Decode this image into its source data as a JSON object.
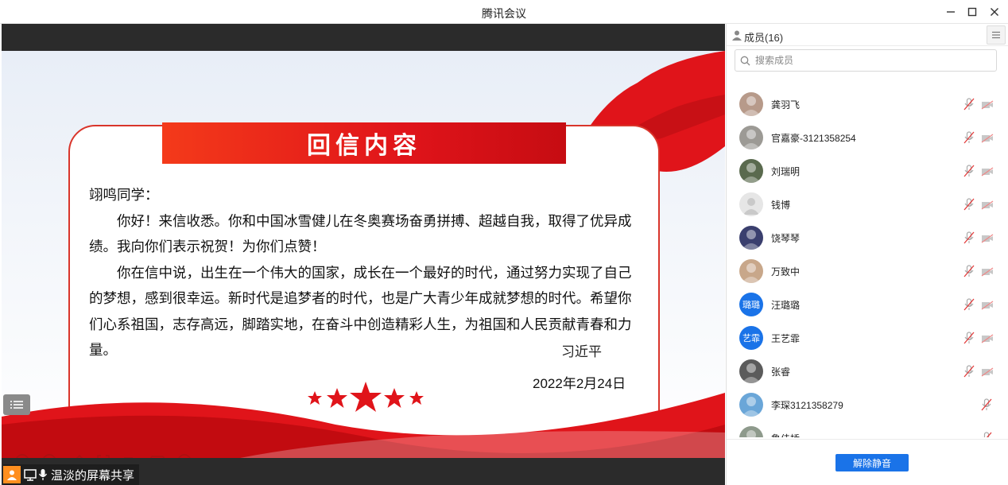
{
  "window": {
    "title": "腾讯会议"
  },
  "slide": {
    "heading": "回信内容",
    "salutation": "翊鸣同学：",
    "paragraph1": "你好！来信收悉。你和中国冰雪健儿在冬奥赛场奋勇拼搏、超越自我，取得了优异成绩。我向你们表示祝贺！为你们点赞！",
    "paragraph2": "你在信中说，出生在一个伟大的国家，成长在一个最好的时代，通过努力实现了自己的梦想，感到很幸运。新时代是追梦者的时代，也是广大青少年成就梦想的时代。希望你们心系祖国，志存高远，脚踏实地，在奋斗中创造精彩人生，为祖国和人民贡献青春和力量。",
    "signature": "习近平",
    "date": "2022年2月24日"
  },
  "share": {
    "label": "温淡的屏幕共享"
  },
  "panel": {
    "title": "成员(16)",
    "search_placeholder": "搜索成员",
    "members": [
      {
        "name": "龚羽飞",
        "avatar": "photo",
        "avatar_color": "#b79a8a",
        "cam": true
      },
      {
        "name": "官嘉豪-3121358254",
        "avatar": "photo",
        "avatar_color": "#9c9a95",
        "cam": true
      },
      {
        "name": "刘瑞明",
        "avatar": "photo",
        "avatar_color": "#5a6a4e",
        "cam": true
      },
      {
        "name": "钱博",
        "avatar": "default",
        "avatar_color": "#e6e6e6",
        "cam": true
      },
      {
        "name": "饶琴琴",
        "avatar": "photo",
        "avatar_color": "#3a3f6e",
        "cam": true
      },
      {
        "name": "万致中",
        "avatar": "photo",
        "avatar_color": "#c8a78a",
        "cam": true
      },
      {
        "name": "汪璐璐",
        "avatar": "text",
        "avatar_text": "璐璐",
        "avatar_color": "#1a73e8",
        "cam": true
      },
      {
        "name": "王艺霏",
        "avatar": "text",
        "avatar_text": "艺霏",
        "avatar_color": "#1a73e8",
        "cam": true
      },
      {
        "name": "张睿",
        "avatar": "photo",
        "avatar_color": "#5b5b5b",
        "cam": true
      },
      {
        "name": "李琛3121358279",
        "avatar": "photo",
        "avatar_color": "#6aa6d8",
        "cam": false
      },
      {
        "name": "鲁佳桥",
        "avatar": "photo",
        "avatar_color": "#8e9a8c",
        "cam": false
      }
    ],
    "unmute_label": "解除静音"
  },
  "colors": {
    "accent": "#1a73e8",
    "slide_red": "#e0141a"
  }
}
